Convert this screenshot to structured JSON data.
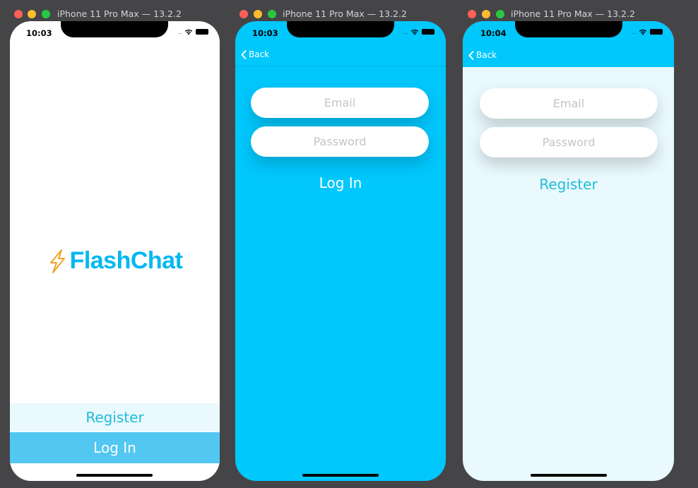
{
  "colors": {
    "desktop": "#454548",
    "brand_blue": "#00c7fc",
    "light_blue": "#e9f9fd",
    "login_button": "#52c7f2",
    "logo_text": "#00b8f0"
  },
  "simulators": [
    {
      "title": "iPhone 11 Pro Max — 13.2.2",
      "time": "10:03",
      "logo_icon": "lightning-bolt-icon",
      "logo_text": "FlashChat",
      "register_label": "Register",
      "login_label": "Log In"
    },
    {
      "title": "iPhone 11 Pro Max — 13.2.2",
      "time": "10:03",
      "back_label": "Back",
      "email_placeholder": "Email",
      "password_placeholder": "Password",
      "action_label": "Log In"
    },
    {
      "title": "iPhone 11 Pro Max — 13.2.2",
      "time": "10:04",
      "back_label": "Back",
      "email_placeholder": "Email",
      "password_placeholder": "Password",
      "action_label": "Register"
    }
  ]
}
